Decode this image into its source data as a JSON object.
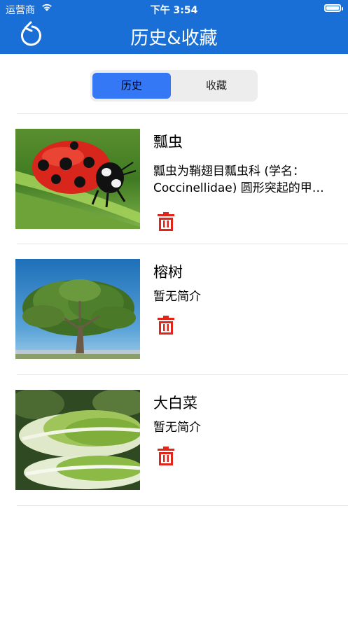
{
  "status_bar": {
    "carrier": "运营商",
    "time": "下午 3:54"
  },
  "nav": {
    "title": "历史&收藏",
    "back_icon": "refresh-back-icon"
  },
  "tabs": [
    {
      "label": "历史",
      "active": true
    },
    {
      "label": "收藏",
      "active": false
    }
  ],
  "items": [
    {
      "title": "瓢虫",
      "desc_line1": "瓢虫为鞘翅目瓢虫科 (学名：",
      "desc_line2": "Coccinellidae) 圆形突起的甲…",
      "image": "ladybug"
    },
    {
      "title": "榕树",
      "desc_line1": "暂无简介",
      "image": "banyan-tree"
    },
    {
      "title": "大白菜",
      "desc_line1": "暂无简介",
      "image": "napa-cabbage"
    }
  ],
  "colors": {
    "accent": "#1a6fd6",
    "active_tab": "#3478f6",
    "delete": "#e0261b"
  }
}
